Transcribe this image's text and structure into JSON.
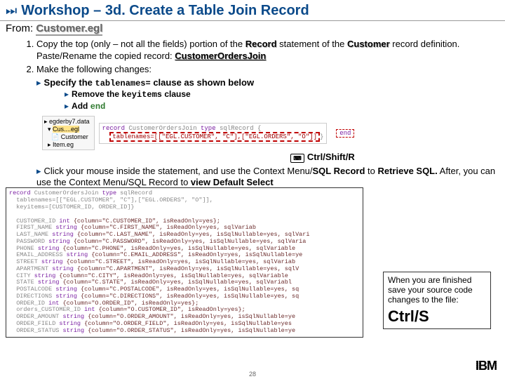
{
  "header": {
    "icon": "⏭",
    "title": "Workshop – 3d. Create a Table Join Record"
  },
  "from": {
    "label": "From: ",
    "file": "Customer.egl"
  },
  "steps": {
    "s1a": "Copy the top (only – not all the fields) portion of the ",
    "s1_record": "Record",
    "s1b": " statement of the ",
    "s1_customer": "Customer",
    "s1c": " record definition.  Paste/Rename the copied record: ",
    "s1_target": "CustomerOrdersJoin",
    "s2": "Make the following changes:",
    "s3a": "Specify the ",
    "s3_kw": "tablenames=",
    "s3b": " clause as shown below",
    "sub1a": "Remove the ",
    "sub1_kw": "keyitems",
    "sub1b": " clause",
    "sub2a": "Add ",
    "sub2_kw": "end",
    "s4a": "Click your mouse inside the statement, and use the Context Menu/",
    "s4_sql": "SQL Record",
    "s4b": " to ",
    "s4_retrieve": "Retrieve SQL.",
    "s4c": "  After, you can use the Context Menu/SQL Record to ",
    "s4_view": "view Default Select"
  },
  "tree": {
    "t1": "egderby7.data",
    "t2": "Cus....egl",
    "t3": "Customer",
    "t4": "Item.eg"
  },
  "code1": {
    "l1a": "record ",
    "l1b": "CustomerOrdersJoin",
    "l1c": " type ",
    "l1d": "sqlRecord {",
    "l2a": "tablenames=[[\"EGL.CUSTOMER\", \"C\"],[\"EGL.ORDERS\", \"O\"]]",
    "l2b": "}",
    "end": "end"
  },
  "ctrlshift": "Ctrl/Shift/R",
  "code2": {
    "lines": [
      "record CustomerOrdersJoin type sqlRecord",
      "  tablenames=[[\"EGL.CUSTOMER\", \"C\"],[\"EGL.ORDERS\", \"O\"]],",
      "  keyitems=[CUSTOMER_ID, ORDER_ID]}",
      "",
      "CUSTOMER_ID int   {column=\"C.CUSTOMER_ID\", isReadOnly=yes};",
      "FIRST_NAME string {column=\"C.FIRST_NAME\", isReadOnly=yes, sqlVariab",
      "LAST_NAME string  {column=\"C.LAST_NAME\", isReadOnly=yes, isSqlNullable=yes, sqlVari",
      "PASSWORD string   {column=\"C.PASSWORD\", isReadOnly=yes, isSqlNullable=yes, sqlVaria",
      "PHONE string      {column=\"C.PHONE\", isReadOnly=yes, isSqlNullable=yes, sqlVariable",
      "EMAIL_ADDRESS string {column=\"C.EMAIL_ADDRESS\", isReadOnly=yes, isSqlNullable=ye",
      "STREET string     {column=\"C.STREET\", isReadOnly=yes, isSqlNullable=yes, sqlVariab",
      "APARTMENT string  {column=\"C.APARTMENT\", isReadOnly=yes, isSqlNullable=yes, sqlV",
      "CITY string       {column=\"C.CITY\", isReadOnly=yes, isSqlNullable=yes, sqlVariable",
      "STATE string      {column=\"C.STATE\", isReadOnly=yes, isSqlNullable=yes, sqlVariabl",
      "POSTALCODE string {column=\"C.POSTALCODE\", isReadOnly=yes, isSqlNullable=yes, sq",
      "DIRECTIONS string {column=\"C.DIRECTIONS\", isReadOnly=yes, isSqlNullable=yes, sq",
      "ORDER_ID int      {column=\"O.ORDER_ID\", isReadOnly=yes};",
      "orders_CUSTOMER_ID int {column=\"O.CUSTOMER_ID\", isReadOnly=yes};",
      "ORDER_AMOUNT string   {column=\"O.ORDER_AMOUNT\", isReadOnly=yes, isSqlNullable=ye",
      "ORDER_FIELD string    {column=\"O.ORDER_FIELD\", isReadOnly=yes, isSqlNullable=yes",
      "ORDER_STATUS string   {column=\"O.ORDER_STATUS\", isReadOnly=yes, isSqlNullable=ye"
    ]
  },
  "savebox": {
    "text": "When you are finished save your source code changes to the file:",
    "ctrl": "Ctrl/S"
  },
  "ibm": "IBM",
  "pagenum": "28"
}
